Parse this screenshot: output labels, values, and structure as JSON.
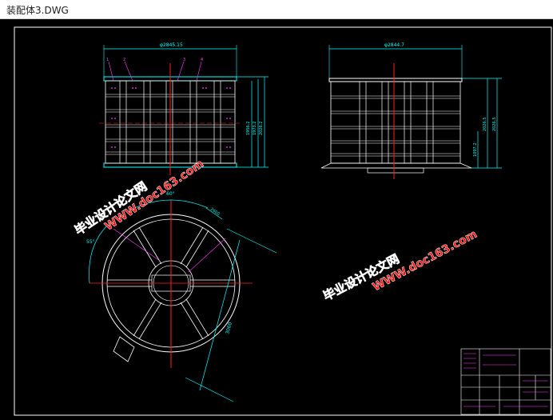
{
  "window": {
    "title": "装配体3.DWG"
  },
  "drawing": {
    "colors": {
      "background": "#000000",
      "frame": "#ffffff",
      "dimension": "#00ffff",
      "centerline": "#ff2020",
      "annotation": "#ff40ff",
      "watermark": "#ff1010",
      "leader": "#ff00ff"
    },
    "front_view": {
      "width_dim": "φ2845.15",
      "height_dims": [
        "1956.2",
        "1973.2",
        "2026.2"
      ],
      "balloons": [
        "1",
        "2",
        "3",
        "4"
      ]
    },
    "side_view": {
      "width_dim": "φ2844.7",
      "height_dims": [
        "1097.2",
        "2026.5",
        "2026.5"
      ]
    },
    "top_view": {
      "angle_dim": "60°",
      "side_angle_dim": "55°",
      "small_dim": "2600",
      "diagonal_dim": "3060"
    },
    "watermarks": [
      {
        "line1": "毕业设计论文网",
        "line2": "WWW.doc163.com"
      },
      {
        "line1": "毕业设计论文网",
        "line2": "WWW.doc163.com"
      }
    ]
  }
}
